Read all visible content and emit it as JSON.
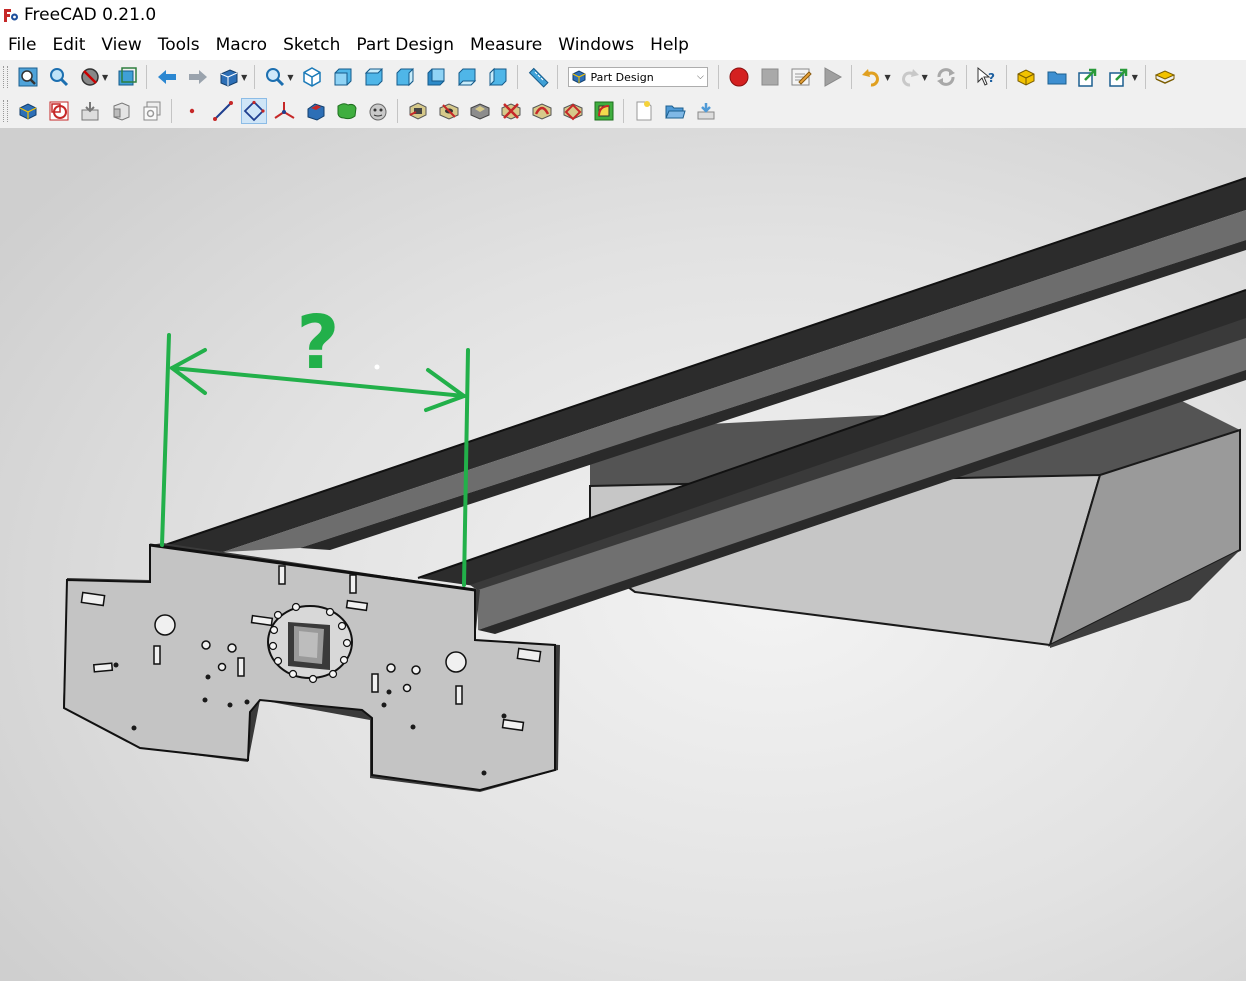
{
  "window": {
    "title": "FreeCAD 0.21.0"
  },
  "menu": [
    "File",
    "Edit",
    "View",
    "Tools",
    "Macro",
    "Sketch",
    "Part Design",
    "Measure",
    "Windows",
    "Help"
  ],
  "workbench": {
    "selected": "Part Design"
  },
  "annotation": {
    "label": "?",
    "color": "#22b04a"
  },
  "colors": {
    "record": "#d42020",
    "brand": "#c62828",
    "viewport_bg": "#e2e2e2"
  },
  "toolbar1_icons": [
    "fit-all-icon",
    "fit-selection-icon",
    "draw-style-icon",
    "bounding-box-icon",
    "back-icon",
    "forward-icon",
    "workbench-views-icon",
    "zoom-icon",
    "isometric-view-icon",
    "front-view-icon",
    "top-view-icon",
    "right-view-icon",
    "rear-view-icon",
    "bottom-view-icon",
    "left-view-icon",
    "measure-icon",
    "record-macro-icon",
    "stop-macro-icon",
    "edit-macro-icon",
    "run-macro-icon",
    "undo-icon",
    "redo-icon",
    "refresh-icon",
    "whats-this-icon",
    "part-icon",
    "group-icon",
    "link-icon",
    "link-actions-icon",
    "std-part-icon"
  ],
  "toolbar2_icons": [
    "create-body-icon",
    "create-sketch-icon",
    "shape-binder-icon",
    "subshape-binder-icon",
    "clone-icon",
    "datum-point-icon",
    "datum-line-icon",
    "datum-plane-icon",
    "local-cs-icon",
    "pad-icon",
    "additive-loft-icon",
    "additive-pipe-icon",
    "pocket-icon",
    "hole-icon",
    "groove-icon",
    "subtractive-loft-icon",
    "subtractive-pipe-icon",
    "subtractive-helix-icon",
    "fillet-icon",
    "new-document-icon",
    "open-document-icon",
    "save-icon"
  ]
}
